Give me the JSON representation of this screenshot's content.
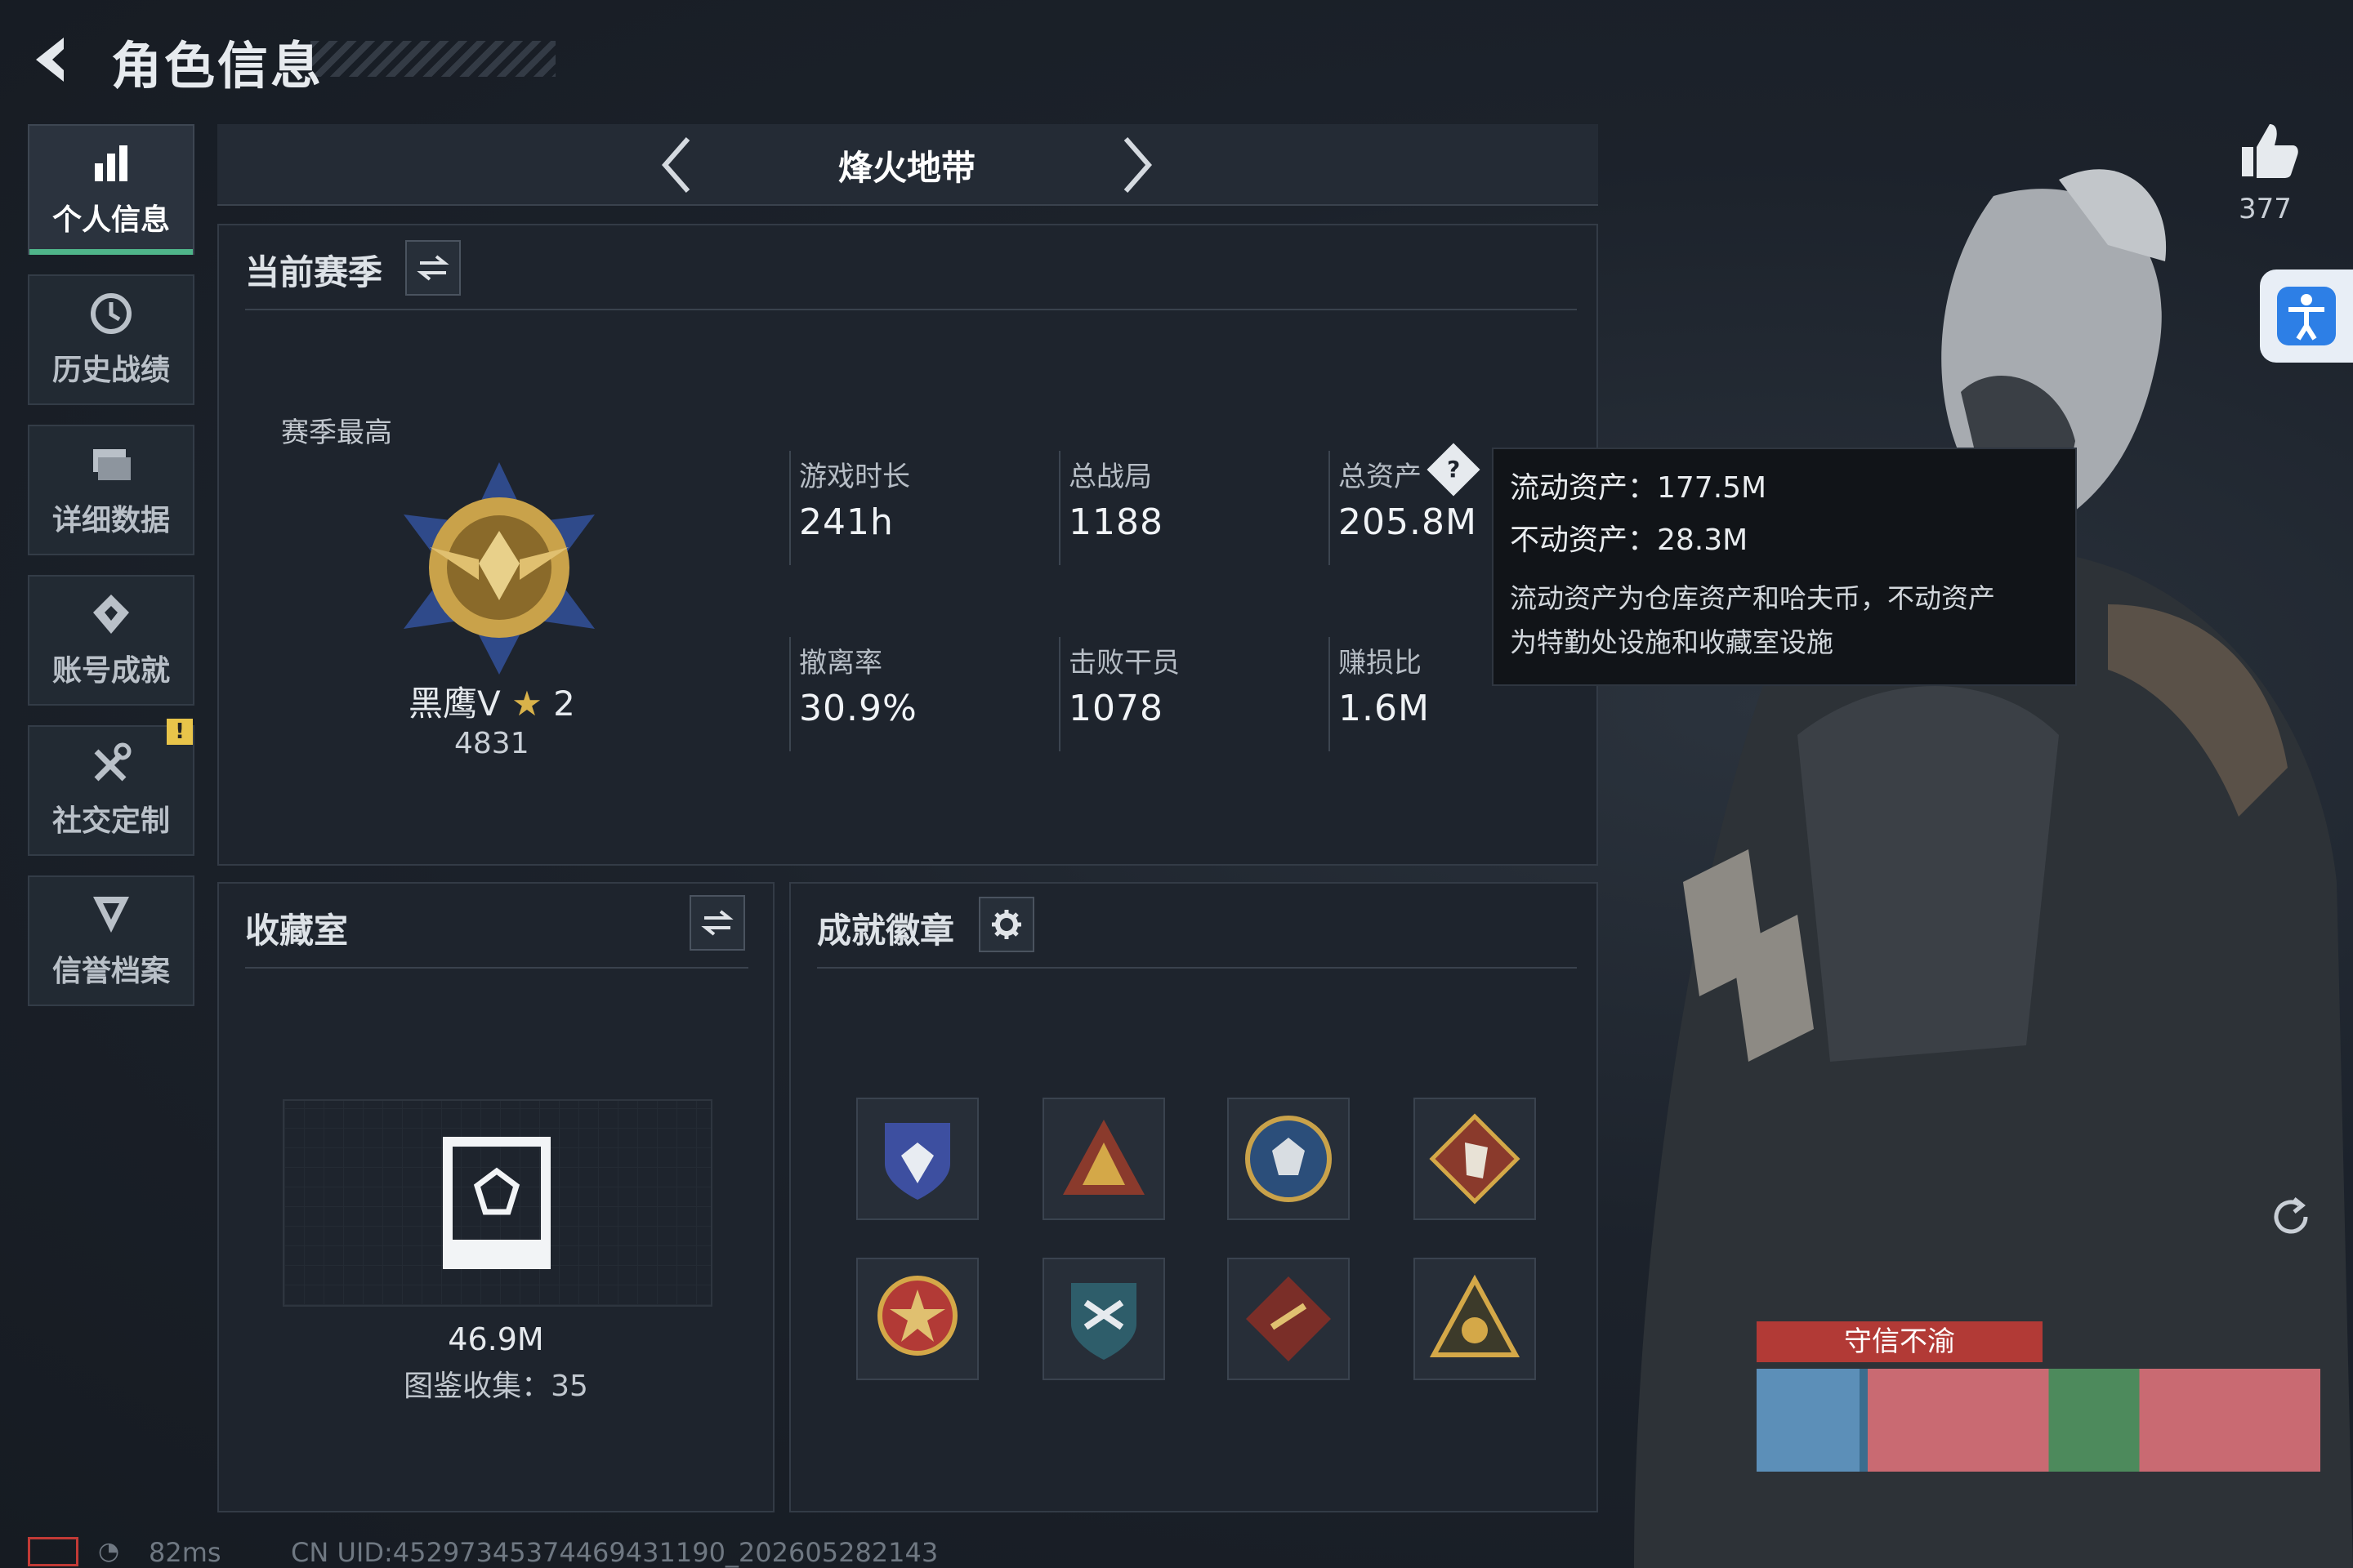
{
  "header": {
    "title": "角色信息"
  },
  "sidebar": {
    "items": [
      {
        "label": "个人信息",
        "icon": "bar-chart-icon"
      },
      {
        "label": "历史战绩",
        "icon": "clock-icon"
      },
      {
        "label": "详细数据",
        "icon": "folder-icon"
      },
      {
        "label": "账号成就",
        "icon": "trophy-icon"
      },
      {
        "label": "社交定制",
        "icon": "tools-icon"
      },
      {
        "label": "信誉档案",
        "icon": "shield-icon"
      }
    ],
    "alert_badge": "!"
  },
  "mode": {
    "title": "烽火地带"
  },
  "season": {
    "title": "当前赛季",
    "best_label": "赛季最高",
    "rank_name": "黑鹰V",
    "rank_stars": "2",
    "rank_score": "4831",
    "stats": [
      {
        "label": "游戏时长",
        "value": "241h"
      },
      {
        "label": "总战局",
        "value": "1188"
      },
      {
        "label": "总资产",
        "value": "205.8M"
      },
      {
        "label": "撤离率",
        "value": "30.9%"
      },
      {
        "label": "击败干员",
        "value": "1078"
      },
      {
        "label": "赚损比",
        "value": "1.6M"
      }
    ]
  },
  "tooltip": {
    "liquid": "流动资产：177.5M",
    "fixed": "不动资产：28.3M",
    "desc_line1": "流动资产为仓库资产和哈夫币，不动资产",
    "desc_line2": "为特勤处设施和收藏室设施"
  },
  "collection": {
    "title": "收藏室",
    "value": "46.9M",
    "catalog": "图鉴收集：35"
  },
  "achievements": {
    "title": "成就徽章",
    "badges": [
      "shield-badge",
      "hand-badge",
      "wolf-badge",
      "horse-badge",
      "star-badge",
      "arrows-badge",
      "weapon-badge",
      "triangle-badge"
    ]
  },
  "social": {
    "likes": "377"
  },
  "nameplate": {
    "title": "守信不渝"
  },
  "status": {
    "ping": "82ms",
    "uid": "CN UID:452973453744694311​90_202605282143"
  },
  "colors": {
    "accent": "#4fb58a",
    "panel": "#1e242d",
    "nameplate": "#b23a36"
  }
}
